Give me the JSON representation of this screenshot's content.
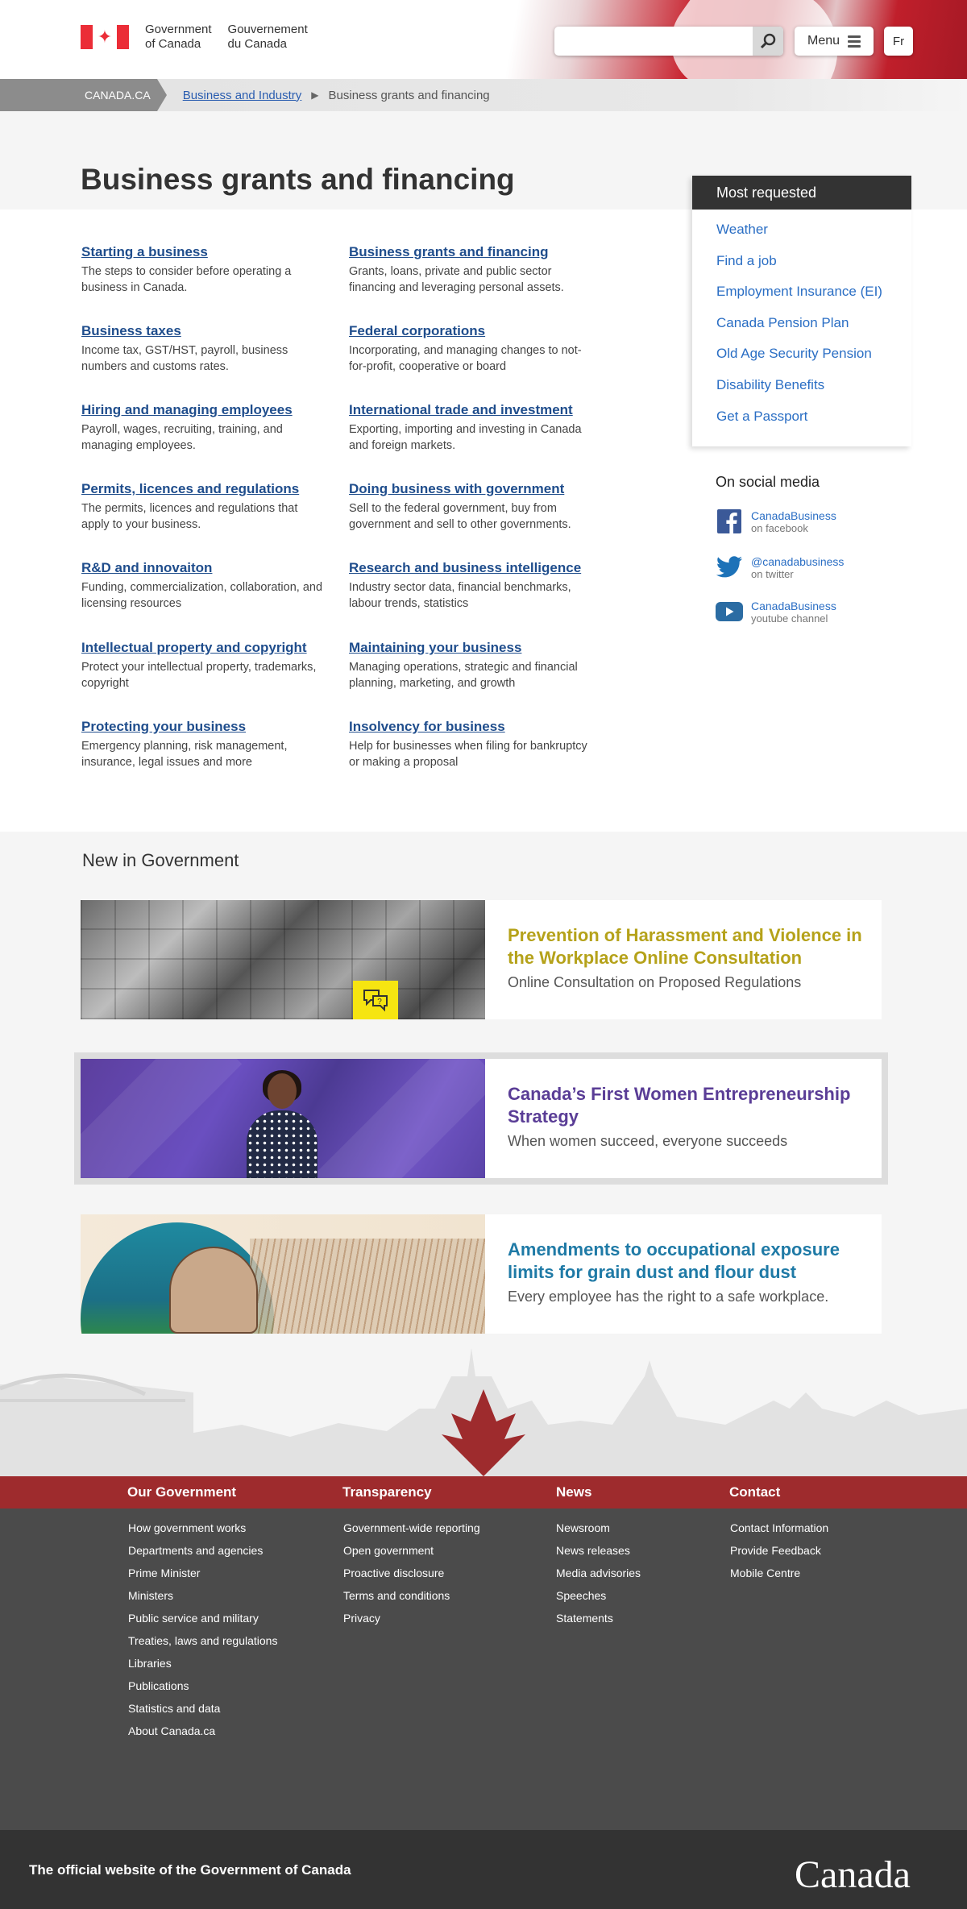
{
  "header": {
    "gov_en_line1": "Government",
    "gov_en_line2": "of Canada",
    "gov_fr_line1": "Gouvernement",
    "gov_fr_line2": "du Canada",
    "search_placeholder": "",
    "menu_label": "Menu",
    "language_toggle": "Fr"
  },
  "breadcrumb": {
    "home": "CANADA.CA",
    "parent": "Business and Industry",
    "current": "Business grants and financing"
  },
  "page_title": "Business grants and financing",
  "topics": [
    {
      "title": "Starting a business",
      "desc": "The steps to consider before operating a business in Canada."
    },
    {
      "title": "Business grants and financing",
      "desc": "Grants, loans, private and public sector financing and leveraging personal assets."
    },
    {
      "title": "Business taxes",
      "desc": "Income tax, GST/HST, payroll, business numbers and customs rates."
    },
    {
      "title": "Federal corporations",
      "desc": "Incorporating, and managing changes to not-for-profit, cooperative or board"
    },
    {
      "title": "Hiring and managing employees",
      "desc": "Payroll, wages, recruiting, training, and managing employees."
    },
    {
      "title": "International trade and investment",
      "desc": "Exporting, importing and investing in Canada and foreign markets."
    },
    {
      "title": "Permits, licences and regulations",
      "desc": "The permits, licences and regulations that apply to your business."
    },
    {
      "title": "Doing business with government",
      "desc": "Sell to the federal government, buy from government and sell to other  governments."
    },
    {
      "title": "R&D and innovaiton",
      "desc": "Funding, commercialization, collaboration, and licensing resources"
    },
    {
      "title": "Research and business intelligence",
      "desc": "Industry sector data, financial benchmarks, labour trends, statistics"
    },
    {
      "title": "Intellectual property and copyright",
      "desc": "Protect your intellectual property, trademarks, copyright"
    },
    {
      "title": "Maintaining your business",
      "desc": "Managing operations, strategic and financial planning, marketing, and growth"
    },
    {
      "title": "Protecting your business",
      "desc": "Emergency planning, risk management, insurance, legal issues and more"
    },
    {
      "title": "Insolvency for business",
      "desc": "Help for businesses when filing for bankruptcy or making a proposal"
    }
  ],
  "most_requested": {
    "title": "Most requested",
    "items": [
      "Weather",
      "Find a job",
      "Employment Insurance (EI)",
      "Canada Pension Plan",
      "Old Age Security Pension",
      "Disability Benefits",
      "Get a Passport"
    ]
  },
  "social": {
    "title": "On social media",
    "items": [
      {
        "account": "CanadaBusiness",
        "platform": "on facebook",
        "icon": "facebook-icon"
      },
      {
        "account": "@canadabusiness",
        "platform": "on twitter",
        "icon": "twitter-icon"
      },
      {
        "account": "CanadaBusiness",
        "platform": "youtube channel",
        "icon": "youtube-icon"
      }
    ]
  },
  "new_in_government": {
    "title": "New in Government",
    "features": [
      {
        "title": "Prevention of Harassment and Violence in the Workplace Online Consultation",
        "subtitle": "Online Consultation on Proposed Regulations",
        "color": "#b5a21a"
      },
      {
        "title": "Canada’s First Women Entrepreneurship Strategy",
        "subtitle": "When women succeed, everyone succeeds",
        "color": "#5a3d96"
      },
      {
        "title": "Amendments to occupational exposure limits for grain dust and flour dust",
        "subtitle": "Every employee has the right to a safe workplace.",
        "color": "#1f7aa6"
      }
    ]
  },
  "footer": {
    "columns": [
      {
        "title": "Our Government",
        "links": [
          "How government works",
          "Departments and agencies",
          "Prime Minister",
          "Ministers",
          "Public service and military",
          "Treaties, laws and regulations",
          "Libraries",
          "Publications",
          "Statistics and data",
          "About Canada.ca"
        ]
      },
      {
        "title": "Transparency",
        "links": [
          "Government-wide reporting",
          "Open government",
          "Proactive disclosure",
          "Terms and conditions",
          "Privacy"
        ]
      },
      {
        "title": "News",
        "links": [
          "Newsroom",
          "News releases",
          "Media advisories",
          "Speeches",
          "Statements"
        ]
      },
      {
        "title": "Contact",
        "links": [
          "Contact Information",
          "Provide Feedback",
          "Mobile Centre"
        ]
      }
    ],
    "official_text": "The official website of the Government of Canada",
    "wordmark": "Canada"
  },
  "colors": {
    "link": "#1f4d8c",
    "mr_link": "#2a6ec4",
    "footer_red": "#9e2b2d",
    "footer_dark": "#4b4b4b",
    "canada_red": "#eb2d37"
  }
}
